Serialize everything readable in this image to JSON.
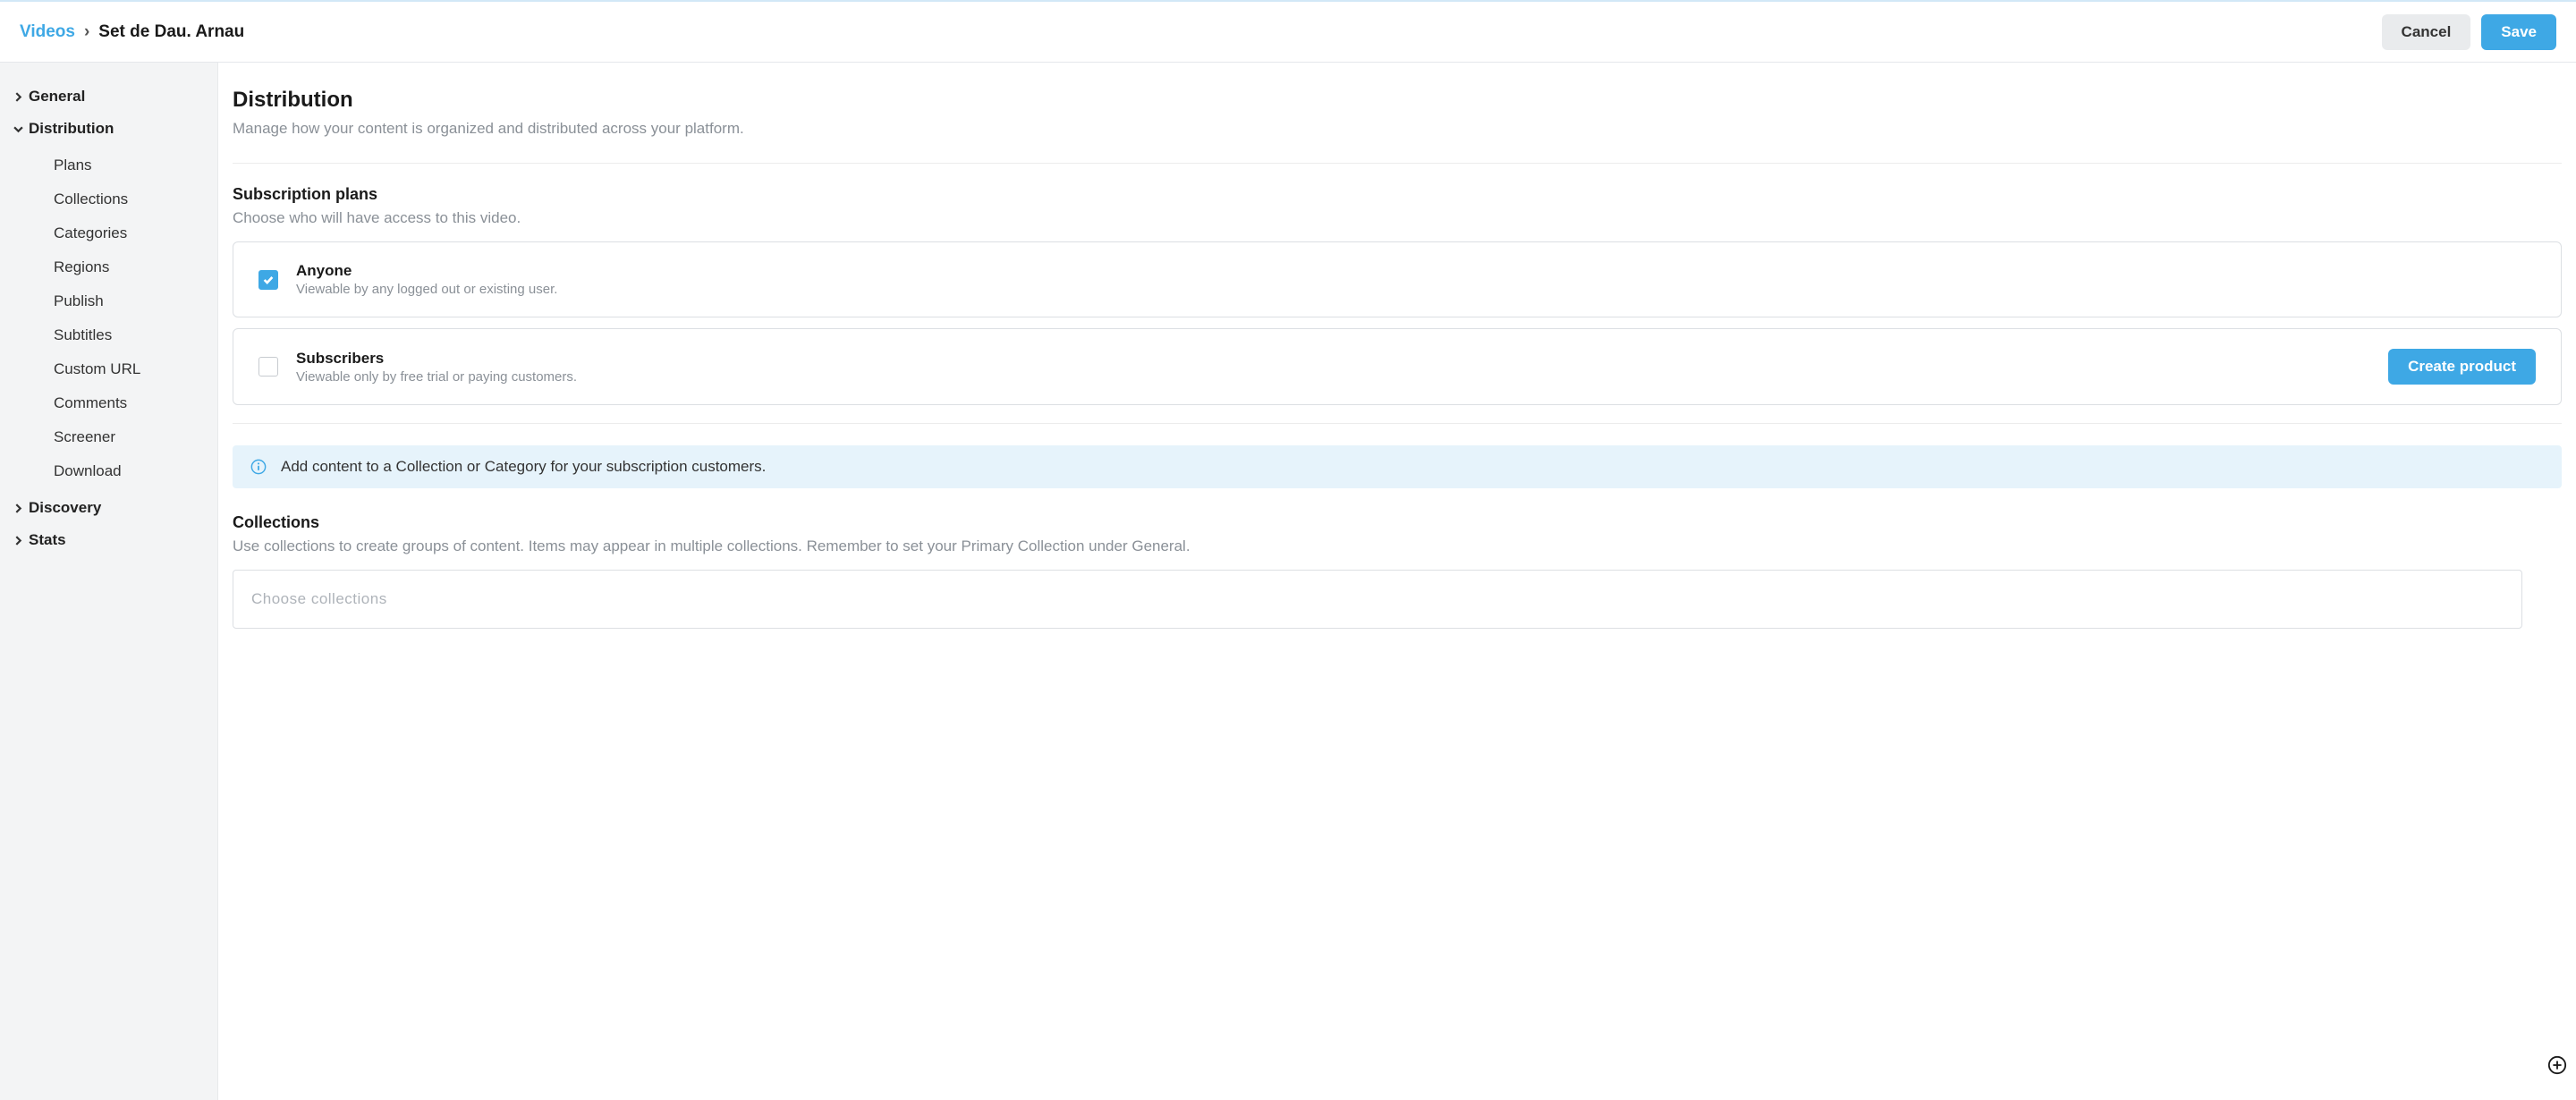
{
  "breadcrumb": {
    "root": "Videos",
    "current": "Set de Dau. Arnau"
  },
  "actions": {
    "cancel": "Cancel",
    "save": "Save"
  },
  "sidebar": {
    "sections": [
      {
        "label": "General",
        "expanded": false,
        "items": []
      },
      {
        "label": "Distribution",
        "expanded": true,
        "items": [
          "Plans",
          "Collections",
          "Categories",
          "Regions",
          "Publish",
          "Subtitles",
          "Custom URL",
          "Comments",
          "Screener",
          "Download"
        ]
      },
      {
        "label": "Discovery",
        "expanded": false,
        "items": []
      },
      {
        "label": "Stats",
        "expanded": false,
        "items": []
      }
    ]
  },
  "page": {
    "title": "Distribution",
    "subtitle": "Manage how your content is organized and distributed across your platform."
  },
  "plans": {
    "heading": "Subscription plans",
    "sub": "Choose who will have access to this video.",
    "options": [
      {
        "title": "Anyone",
        "desc": "Viewable by any logged out or existing user.",
        "checked": true
      },
      {
        "title": "Subscribers",
        "desc": "Viewable only by free trial or paying customers.",
        "checked": false
      }
    ],
    "create_product": "Create product"
  },
  "banner": {
    "text": "Add content to a Collection or Category for your subscription customers."
  },
  "collections": {
    "heading": "Collections",
    "sub": "Use collections to create groups of content. Items may appear in multiple collections. Remember to set your Primary Collection under General.",
    "placeholder": "Choose collections"
  }
}
